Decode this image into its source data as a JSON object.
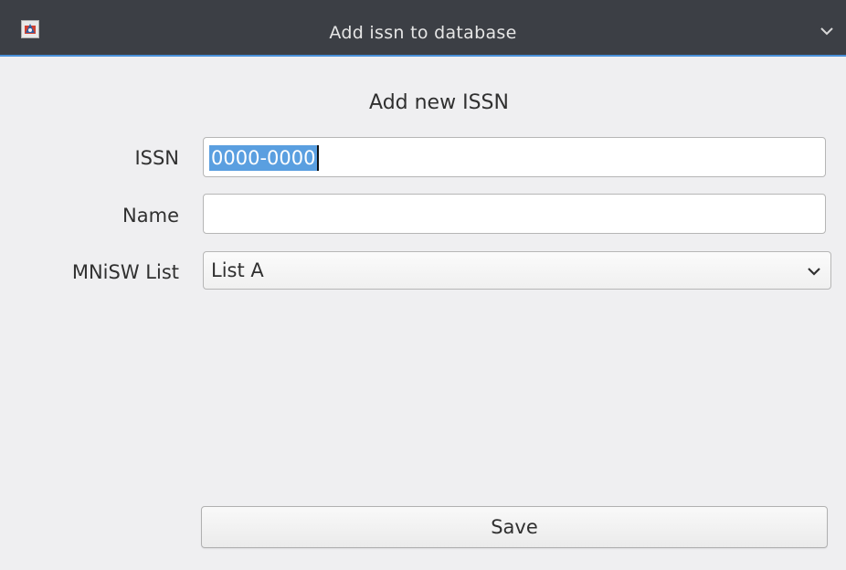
{
  "window": {
    "title": "Add issn to database",
    "app_icon": "java-app-icon",
    "menu_icon": "chevron-down-icon"
  },
  "form": {
    "heading": "Add new ISSN",
    "issn": {
      "label": "ISSN",
      "value": "0000-0000",
      "selected": true
    },
    "name": {
      "label": "Name",
      "value": ""
    },
    "mnisw_list": {
      "label": "MNiSW List",
      "selected": "List A"
    },
    "save_label": "Save"
  },
  "colors": {
    "titlebar": "#3c3f45",
    "accent": "#4a90d9",
    "selection": "#5a9fe0",
    "background": "#efeff1"
  }
}
